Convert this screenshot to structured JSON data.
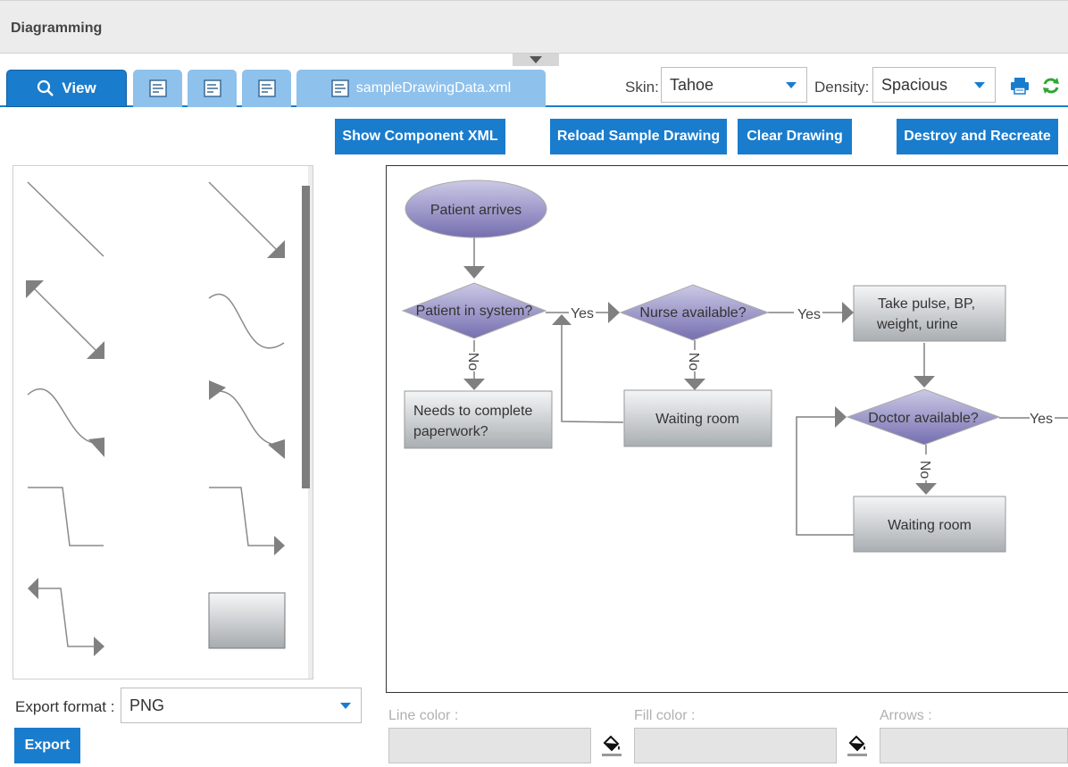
{
  "app": {
    "title": "Diagramming"
  },
  "tabs": [
    {
      "label": "View",
      "icon": "magnifier-icon"
    },
    {
      "label": "",
      "icon": "document-icon"
    },
    {
      "label": "",
      "icon": "document-icon"
    },
    {
      "label": "",
      "icon": "document-icon"
    },
    {
      "label": "sampleDrawingData.xml",
      "icon": "document-icon"
    }
  ],
  "toolbar": {
    "skin_label": "Skin:",
    "skin_value": "Tahoe",
    "density_label": "Density:",
    "density_value": "Spacious",
    "print_icon": "printer-icon",
    "refresh_icon": "refresh-icon"
  },
  "actions": {
    "show_xml": "Show Component XML",
    "reload": "Reload Sample Drawing",
    "clear": "Clear Drawing",
    "destroy": "Destroy and Recreate"
  },
  "palette": {
    "items": [
      "line",
      "line-arrow",
      "double-arrow-line",
      "curve",
      "curve-arrow",
      "curve-double-arrow",
      "elbow-line",
      "elbow-arrow",
      "elbow-double-arrow",
      "rectangle"
    ]
  },
  "flowchart": {
    "nodes": {
      "patient_arrives": "Patient arrives",
      "patient_in_system": "Patient in system?",
      "nurse_available": "Nurse available?",
      "vitals_line1": "Take pulse, BP,",
      "vitals_line2": "weight, urine",
      "paperwork_line1": "Needs to complete",
      "paperwork_line2": "paperwork?",
      "waiting_room_1": "Waiting room",
      "doctor_available": "Doctor available?",
      "waiting_room_2": "Waiting room"
    },
    "edges": {
      "yes": "Yes",
      "no": "No"
    }
  },
  "properties": {
    "line_color_label": "Line color :",
    "fill_color_label": "Fill color :",
    "arrows_label": "Arrows :"
  },
  "export": {
    "format_label": "Export format :",
    "format_value": "PNG",
    "button": "Export"
  },
  "colors": {
    "accent": "#1a7ccd",
    "tab_inactive": "#8ec1ec",
    "diamond_top": "#c8c6e4",
    "diamond_bottom": "#7570ae"
  }
}
